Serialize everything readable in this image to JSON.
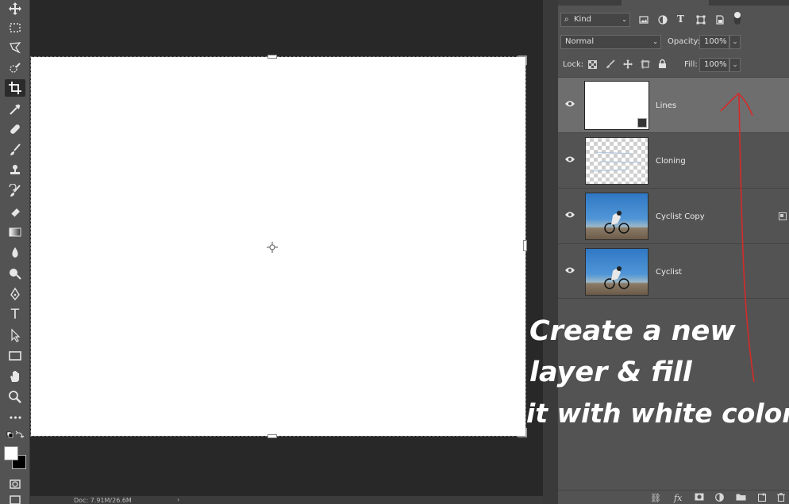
{
  "toolbar": {
    "tools": [
      "move-tool",
      "marquee-tool",
      "lasso-tool",
      "quick-selection-tool",
      "crop-tool",
      "eyedropper-tool",
      "healing-brush-tool",
      "brush-tool",
      "clone-stamp-tool",
      "history-brush-tool",
      "eraser-tool",
      "gradient-tool",
      "blur-tool",
      "dodge-tool",
      "pen-tool",
      "type-tool",
      "path-selection-tool",
      "rectangle-tool",
      "hand-tool",
      "zoom-tool",
      "more-tools",
      "color-swatches",
      "quick-mask-mode"
    ],
    "type_tool_glyph": "T",
    "more_glyph": "•••"
  },
  "status": {
    "doc_info": "Doc: 7.91M/26.6M",
    "arrow": "›"
  },
  "layers_panel": {
    "filter": {
      "kind_label": "Kind"
    },
    "blend_mode": "Normal",
    "opacity_label": "Opacity:",
    "opacity_value": "100%",
    "lock_label": "Lock:",
    "fill_label": "Fill:",
    "fill_value": "100%",
    "type_filter_glyph": "T",
    "layers": [
      {
        "name": "Lines",
        "thumbnail": "white",
        "selected": true,
        "visible": true
      },
      {
        "name": "Cloning",
        "thumbnail": "transparent",
        "selected": false,
        "visible": true
      },
      {
        "name": "Cyclist Copy",
        "thumbnail": "photo",
        "selected": false,
        "visible": true
      },
      {
        "name": "Cyclist",
        "thumbnail": "photo",
        "selected": false,
        "visible": true
      }
    ],
    "bottom_icons": [
      "link-icon",
      "fx-icon",
      "mask-icon",
      "adjustment-icon",
      "group-icon",
      "new-layer-icon",
      "trash-icon"
    ],
    "fx_glyph": "fx"
  },
  "annotation": {
    "lines": [
      "Create a new",
      "layer & fill",
      "it with white color"
    ],
    "color": "#ffffff",
    "arrow_color": "#d42b2b"
  }
}
